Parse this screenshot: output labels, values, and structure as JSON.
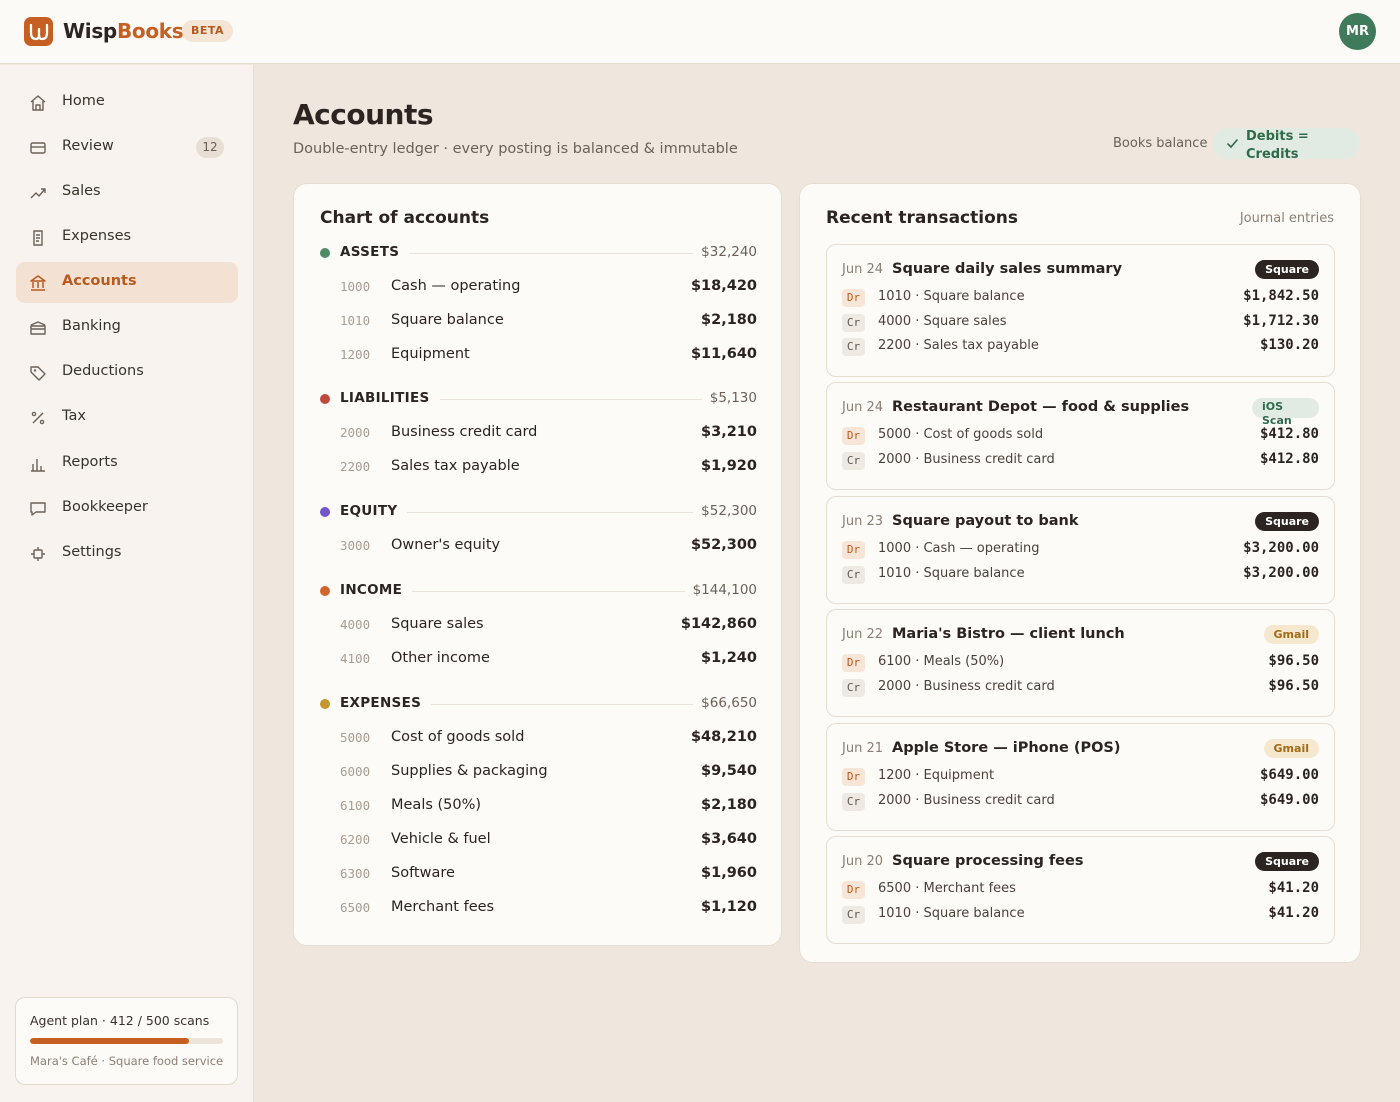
{
  "app": {
    "brand_part1": "Wisp",
    "brand_part2": "Books",
    "badge": "BETA",
    "user_initials": "MR"
  },
  "sidebar": {
    "items": [
      {
        "label": "Home",
        "icon": "home-icon"
      },
      {
        "label": "Review",
        "icon": "inbox-icon",
        "badge": "12"
      },
      {
        "label": "Sales",
        "icon": "trend-icon"
      },
      {
        "label": "Expenses",
        "icon": "receipt-icon"
      },
      {
        "label": "Accounts",
        "icon": "bank-icon",
        "active": true
      },
      {
        "label": "Banking",
        "icon": "wallet-icon"
      },
      {
        "label": "Deductions",
        "icon": "tag-icon"
      },
      {
        "label": "Tax",
        "icon": "percent-icon"
      },
      {
        "label": "Reports",
        "icon": "bar-chart-icon"
      },
      {
        "label": "Bookkeeper",
        "icon": "chat-icon"
      },
      {
        "label": "Settings",
        "icon": "settings-icon"
      }
    ],
    "plan": {
      "title": "Agent plan · 412 / 500 scans",
      "used": 412,
      "limit": 500,
      "business": "Mara's Café · Square food service"
    }
  },
  "page": {
    "title": "Accounts",
    "subtitle": "Double-entry ledger · every posting is balanced & immutable",
    "balance_label": "Books balance",
    "balance_status": "Debits = Credits"
  },
  "chart_of_accounts": {
    "title": "Chart of accounts",
    "sections": [
      {
        "name": "ASSETS",
        "total": "$32,240",
        "color": "#4f8a67",
        "accounts": [
          {
            "code": "1000",
            "name": "Cash — operating",
            "amount": "$18,420"
          },
          {
            "code": "1010",
            "name": "Square balance",
            "amount": "$2,180"
          },
          {
            "code": "1200",
            "name": "Equipment",
            "amount": "$11,640"
          }
        ]
      },
      {
        "name": "LIABILITIES",
        "total": "$5,130",
        "color": "#c0493c",
        "accounts": [
          {
            "code": "2000",
            "name": "Business credit card",
            "amount": "$3,210"
          },
          {
            "code": "2200",
            "name": "Sales tax payable",
            "amount": "$1,920"
          }
        ]
      },
      {
        "name": "EQUITY",
        "total": "$52,300",
        "color": "#7356c9",
        "accounts": [
          {
            "code": "3000",
            "name": "Owner's equity",
            "amount": "$52,300"
          }
        ]
      },
      {
        "name": "INCOME",
        "total": "$144,100",
        "color": "#d0662a",
        "accounts": [
          {
            "code": "4000",
            "name": "Square sales",
            "amount": "$142,860"
          },
          {
            "code": "4100",
            "name": "Other income",
            "amount": "$1,240"
          }
        ]
      },
      {
        "name": "EXPENSES",
        "total": "$66,650",
        "color": "#c5962c",
        "accounts": [
          {
            "code": "5000",
            "name": "Cost of goods sold",
            "amount": "$48,210"
          },
          {
            "code": "6000",
            "name": "Supplies & packaging",
            "amount": "$9,540"
          },
          {
            "code": "6100",
            "name": "Meals (50%)",
            "amount": "$2,180"
          },
          {
            "code": "6200",
            "name": "Vehicle & fuel",
            "amount": "$3,640"
          },
          {
            "code": "6300",
            "name": "Software",
            "amount": "$1,960"
          },
          {
            "code": "6500",
            "name": "Merchant fees",
            "amount": "$1,120"
          }
        ]
      }
    ]
  },
  "transactions": {
    "title": "Recent transactions",
    "aside": "Journal entries",
    "items": [
      {
        "date": "Jun 24",
        "title": "Square daily sales summary",
        "source": "Square",
        "source_kind": "square",
        "lines": [
          {
            "side": "Dr",
            "account": "1010 · Square balance",
            "amount": "$1,842.50"
          },
          {
            "side": "Cr",
            "account": "4000 · Square sales",
            "amount": "$1,712.30"
          },
          {
            "side": "Cr",
            "account": "2200 · Sales tax payable",
            "amount": "$130.20"
          }
        ]
      },
      {
        "date": "Jun 24",
        "title": "Restaurant Depot — food & supplies",
        "source": "iOS Scan",
        "source_kind": "ios",
        "lines": [
          {
            "side": "Dr",
            "account": "5000 · Cost of goods sold",
            "amount": "$412.80"
          },
          {
            "side": "Cr",
            "account": "2000 · Business credit card",
            "amount": "$412.80"
          }
        ]
      },
      {
        "date": "Jun 23",
        "title": "Square payout to bank",
        "source": "Square",
        "source_kind": "square",
        "lines": [
          {
            "side": "Dr",
            "account": "1000 · Cash — operating",
            "amount": "$3,200.00"
          },
          {
            "side": "Cr",
            "account": "1010 · Square balance",
            "amount": "$3,200.00"
          }
        ]
      },
      {
        "date": "Jun 22",
        "title": "Maria's Bistro — client lunch",
        "source": "Gmail",
        "source_kind": "gmail",
        "lines": [
          {
            "side": "Dr",
            "account": "6100 · Meals (50%)",
            "amount": "$96.50"
          },
          {
            "side": "Cr",
            "account": "2000 · Business credit card",
            "amount": "$96.50"
          }
        ]
      },
      {
        "date": "Jun 21",
        "title": "Apple Store — iPhone (POS)",
        "source": "Gmail",
        "source_kind": "gmail",
        "lines": [
          {
            "side": "Dr",
            "account": "1200 · Equipment",
            "amount": "$649.00"
          },
          {
            "side": "Cr",
            "account": "2000 · Business credit card",
            "amount": "$649.00"
          }
        ]
      },
      {
        "date": "Jun 20",
        "title": "Square processing fees",
        "source": "Square",
        "source_kind": "square",
        "lines": [
          {
            "side": "Dr",
            "account": "6500 · Merchant fees",
            "amount": "$41.20"
          },
          {
            "side": "Cr",
            "account": "1010 · Square balance",
            "amount": "$41.20"
          }
        ]
      }
    ]
  }
}
